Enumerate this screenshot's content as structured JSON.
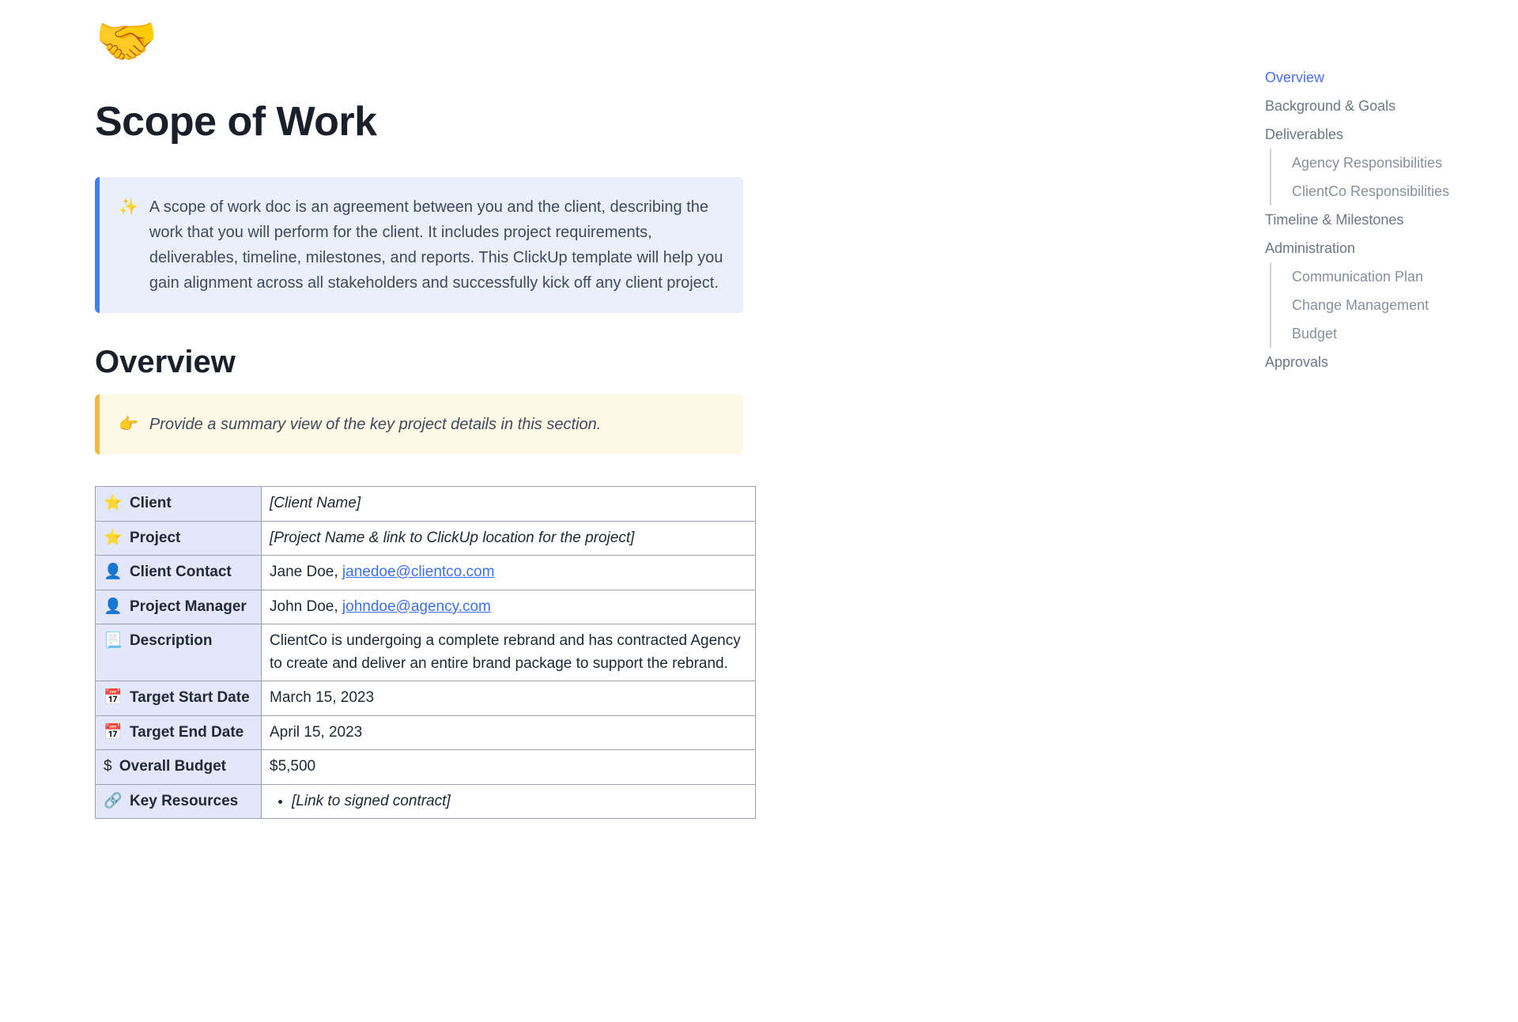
{
  "page": {
    "icon": "🤝",
    "title": "Scope of Work"
  },
  "intro_callout": {
    "icon": "✨",
    "text": "A scope of work doc is an agreement between you and the client, describing the work that you will perform for the client. It includes project requirements, deliverables, timeline, milestones, and reports. This ClickUp template will help you gain alignment across all stakeholders and successfully kick off any client project."
  },
  "overview": {
    "heading": "Overview",
    "hint_icon": "👉",
    "hint_text": "Provide a summary view of the key project details in this section.",
    "rows": {
      "client": {
        "icon": "⭐",
        "label": "Client",
        "value": "[Client Name]"
      },
      "project": {
        "icon": "⭐",
        "label": "Project",
        "value": "[Project Name & link to ClickUp location for the project]"
      },
      "client_contact": {
        "icon": "👤",
        "label": "Client Contact",
        "name": "Jane Doe, ",
        "email": "janedoe@clientco.com"
      },
      "project_manager": {
        "icon": "👤",
        "label": "Project Manager",
        "name": "John Doe, ",
        "email": "johndoe@agency.com"
      },
      "description": {
        "icon": "📃",
        "label": "Description",
        "value": "ClientCo is undergoing a complete rebrand and has contracted Agency to create and deliver an entire brand package to support the rebrand."
      },
      "start_date": {
        "icon": "📅",
        "label": "Target Start Date",
        "value": "March 15, 2023"
      },
      "end_date": {
        "icon": "📅",
        "label": "Target End Date",
        "value": "April 15, 2023"
      },
      "budget": {
        "icon": "$",
        "label": "Overall Budget",
        "value": "$5,500"
      },
      "resources": {
        "icon": "🔗",
        "label": "Key Resources",
        "item1": "[Link to signed contract]"
      }
    }
  },
  "toc": {
    "items": [
      {
        "label": "Overview",
        "active": true,
        "sub": false
      },
      {
        "label": "Background & Goals",
        "active": false,
        "sub": false
      },
      {
        "label": "Deliverables",
        "active": false,
        "sub": false
      },
      {
        "label": "Agency Responsibilities",
        "active": false,
        "sub": true
      },
      {
        "label": "ClientCo Responsibilities",
        "active": false,
        "sub": true
      },
      {
        "label": "Timeline & Milestones",
        "active": false,
        "sub": false
      },
      {
        "label": "Administration",
        "active": false,
        "sub": false
      },
      {
        "label": "Communication Plan",
        "active": false,
        "sub": true
      },
      {
        "label": "Change Management",
        "active": false,
        "sub": true
      },
      {
        "label": "Budget",
        "active": false,
        "sub": true
      },
      {
        "label": "Approvals",
        "active": false,
        "sub": false
      }
    ]
  }
}
